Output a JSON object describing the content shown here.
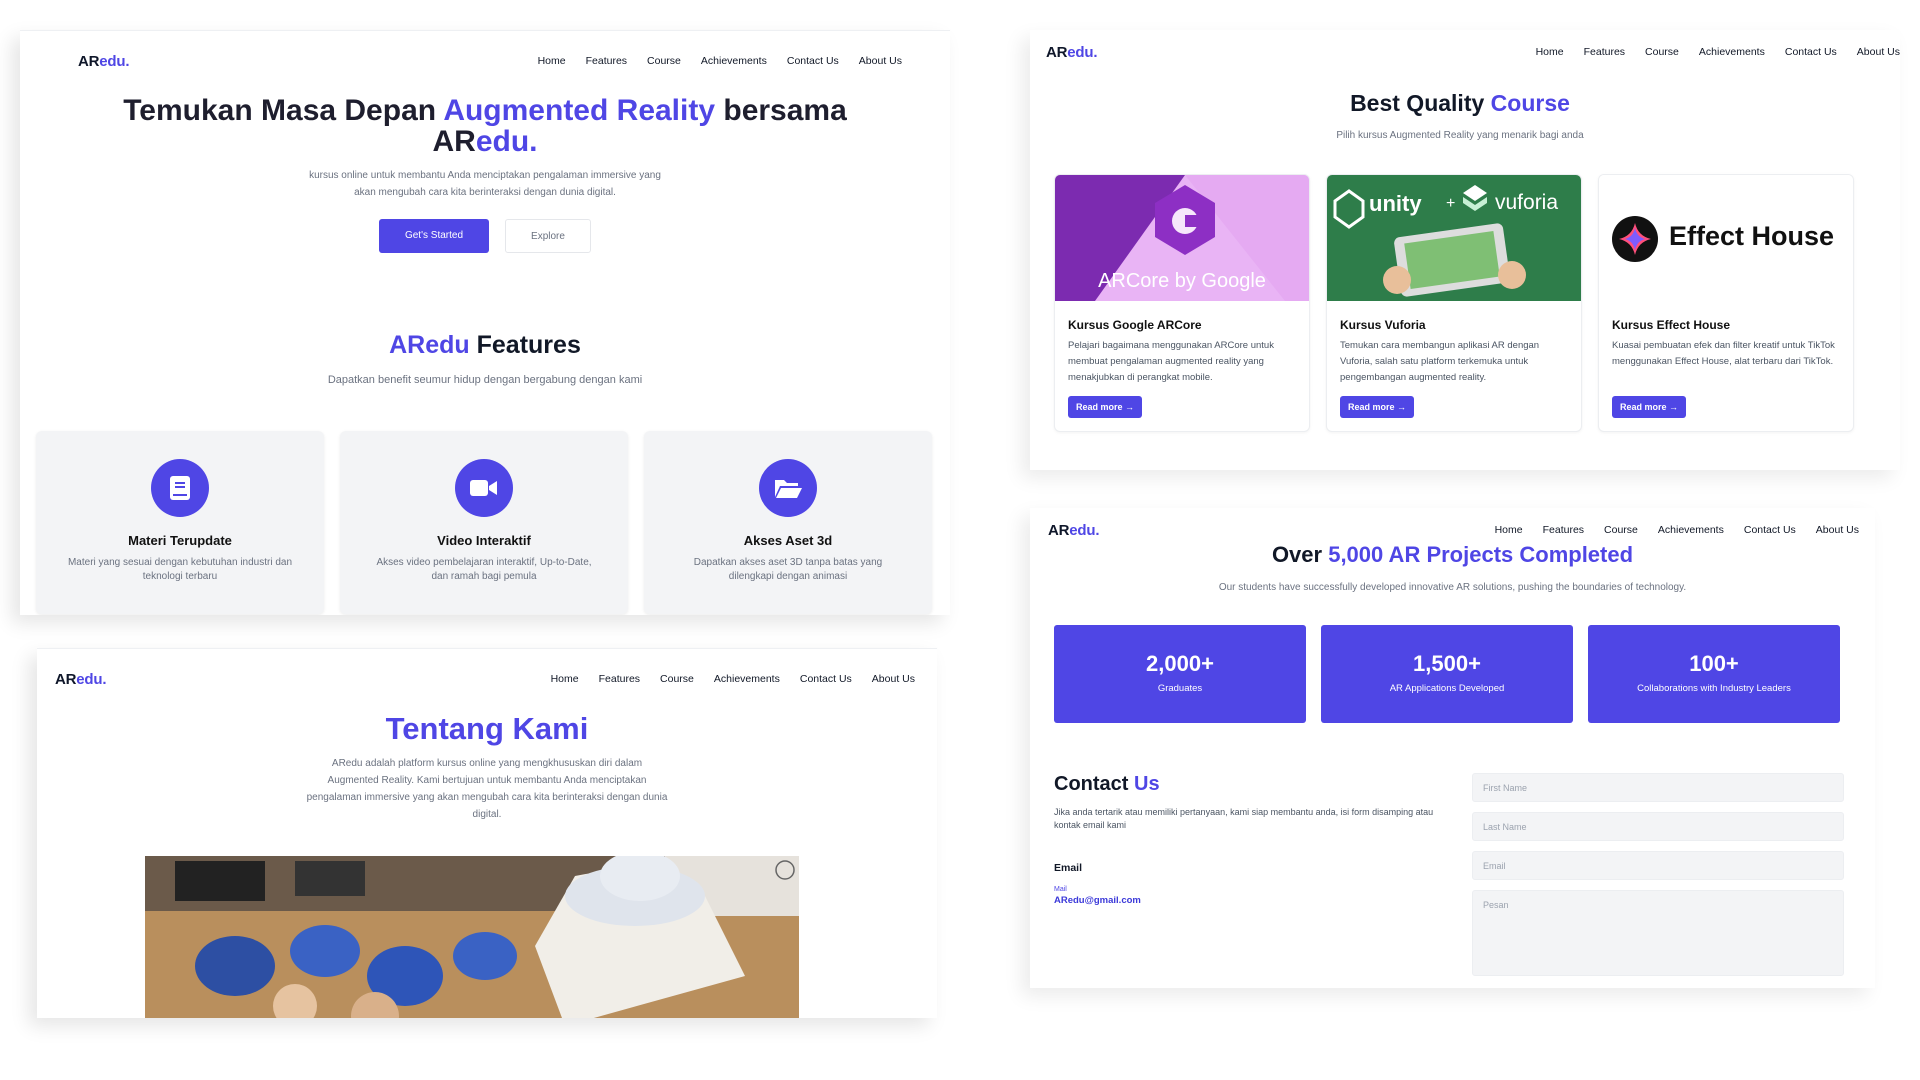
{
  "nav": {
    "logo_prefix": "AR",
    "logo_suffix": "edu.",
    "items": [
      "Home",
      "Features",
      "Course",
      "Achievements",
      "Contact Us",
      "About Us"
    ]
  },
  "hero": {
    "title_part1": "Temukan Masa Depan ",
    "title_accent": "Augmented Reality",
    "title_part2": " bersama",
    "title_line2_prefix": "AR",
    "title_line2_accent": "edu.",
    "subtitle_line1": "kursus online untuk membantu Anda menciptakan pengalaman immersive yang",
    "subtitle_line2": "akan mengubah cara kita berinteraksi dengan dunia digital.",
    "primary_button": "Get's Started",
    "secondary_button": "Explore"
  },
  "features": {
    "title_accent": "ARedu",
    "title_rest": " Features",
    "subtitle": "Dapatkan benefit seumur hidup dengan bergabung dengan kami",
    "cards": [
      {
        "icon": "book-icon",
        "title": "Materi Terupdate",
        "desc": "Materi yang sesuai dengan kebutuhan industri dan teknologi terbaru"
      },
      {
        "icon": "video-camera-icon",
        "title": "Video Interaktif",
        "desc": "Akses video pembelajaran interaktif, Up-to-Date, dan ramah bagi pemula"
      },
      {
        "icon": "folder-open-icon",
        "title": "Akses Aset 3d",
        "desc": "Dapatkan akses aset 3D tanpa batas yang dilengkapi dengan animasi"
      }
    ]
  },
  "about": {
    "title": "Tentang Kami",
    "desc_lines": [
      "ARedu adalah platform kursus online yang mengkhususkan diri dalam",
      "Augmented Reality. Kami bertujuan untuk membantu Anda menciptakan",
      "pengalaman immersive yang akan mengubah cara kita berinteraksi dengan dunia",
      "digital."
    ]
  },
  "courses": {
    "title_rest": "Best Quality ",
    "title_accent": "Course",
    "subtitle": "Pilih kursus Augmented Reality yang menarik bagi anda",
    "read_more": "Read more",
    "cards": [
      {
        "image_text": "ARCore by Google",
        "title": "Kursus Google ARCore",
        "desc": "Pelajari bagaimana menggunakan ARCore untuk membuat pengalaman augmented reality yang menakjubkan di perangkat mobile."
      },
      {
        "image_text_left": "unity",
        "image_text_plus": "+",
        "image_text_right": "vuforia",
        "title": "Kursus Vuforia",
        "desc": "Temukan cara membangun aplikasi AR dengan Vuforia, salah satu platform terkemuka untuk pengembangan augmented reality."
      },
      {
        "image_text": "Effect House",
        "title": "Kursus Effect House",
        "desc": "Kuasai pembuatan efek dan filter kreatif untuk TikTok menggunakan Effect House, alat terbaru dari TikTok."
      }
    ]
  },
  "achievements": {
    "title_part1": "Over ",
    "title_accent": "5,000 AR Projects Completed",
    "subtitle": "Our students have successfully developed innovative AR solutions, pushing the boundaries of technology.",
    "stats": [
      {
        "value": "2,000+",
        "label": "Graduates"
      },
      {
        "value": "1,500+",
        "label": "AR Applications Developed"
      },
      {
        "value": "100+",
        "label": "Collaborations with Industry Leaders"
      }
    ]
  },
  "contact": {
    "title_part1": "Contact ",
    "title_accent": "Us",
    "desc": "Jika anda tertarik atau memiliki pertanyaan, kami siap membantu anda, isi form disamping atau kontak email kami",
    "email_heading": "Email",
    "mail_label": "Mail",
    "email": "ARedu@gmail.com",
    "fields": {
      "first_name": "First Name",
      "last_name": "Last Name",
      "email": "Email",
      "message": "Pesan"
    }
  },
  "colors": {
    "accent": "#4f46e5",
    "text": "#111827",
    "muted": "#6b7280"
  }
}
